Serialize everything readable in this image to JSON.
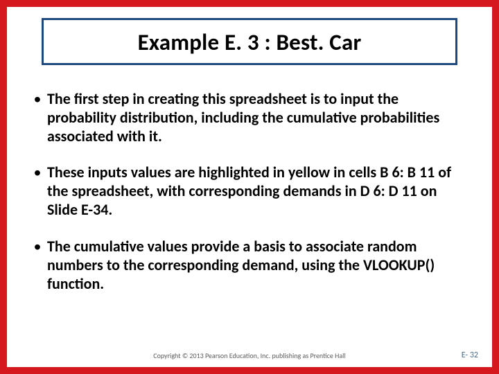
{
  "title": "Example E. 3 : Best. Car",
  "bullets": [
    "The first step in creating this spreadsheet is to input the probability distribution, including the cumulative probabilities associated with it.",
    "These inputs values are highlighted in yellow in cells B 6: B 11 of the spreadsheet, with corresponding demands in D 6: D 11 on Slide E-34.",
    "The cumulative values provide a basis to associate random numbers to the corresponding demand, using the VLOOKUP() function."
  ],
  "footer": {
    "copyright": "Copyright © 2013 Pearson Education, Inc. publishing as Prentice Hall",
    "page": "E- 32"
  },
  "colors": {
    "border": "#d5171e",
    "title_border": "#1f497d"
  }
}
